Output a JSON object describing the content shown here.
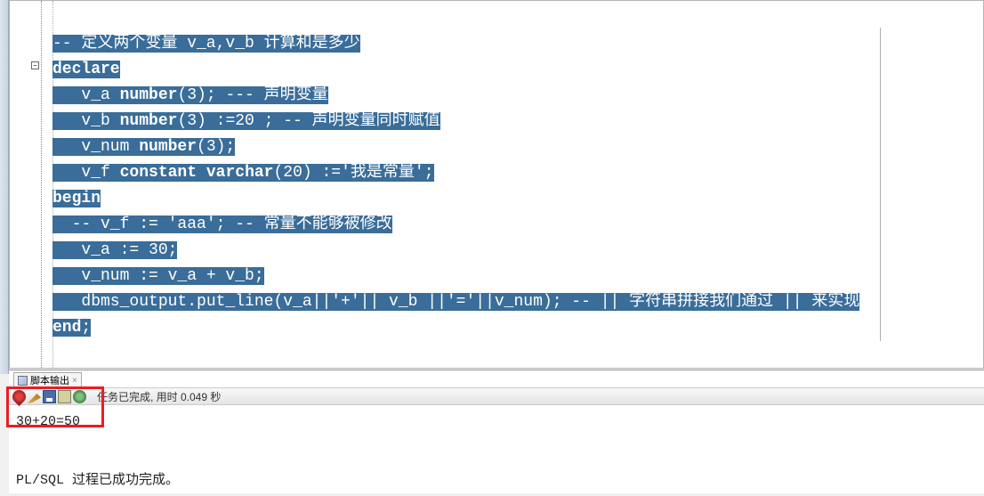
{
  "code": {
    "line1_comment": "-- 定义两个变量 v_a,v_b 计算和是多少",
    "declare_kw": "declare",
    "line3_pre": "   v_a ",
    "line3_kw": "number",
    "line3_post": "(3); --- 声明变量",
    "line4_pre": "   v_b ",
    "line4_kw": "number",
    "line4_post": "(3) :=20 ; -- 声明变量同时赋值",
    "line5_pre": "   v_num ",
    "line5_kw": "number",
    "line5_post": "(3);",
    "line6_pre": "   v_f ",
    "line6_kw1": "constant",
    "line6_mid": " ",
    "line6_kw2": "varchar",
    "line6_post": "(20) :='我是常量';",
    "begin_kw": "begin",
    "line8": "  -- v_f := 'aaa'; -- 常量不能够被修改",
    "line9": "   v_a := 30;",
    "line10": "   v_num := v_a + v_b;",
    "line11": "   dbms_output.put_line(v_a||'+'|| v_b ||'='||v_num); -- || 字符串拼接我们通过 || 来实现",
    "end_kw": "end",
    "end_post": ";"
  },
  "output_tab": {
    "label": "脚本输出",
    "close": "×"
  },
  "toolbar": {
    "status": "任务已完成,  用时 0.049 秒"
  },
  "output": {
    "result": "30+20=50",
    "completion": "PL/SQL 过程已成功完成。"
  },
  "fold_marker": "−"
}
